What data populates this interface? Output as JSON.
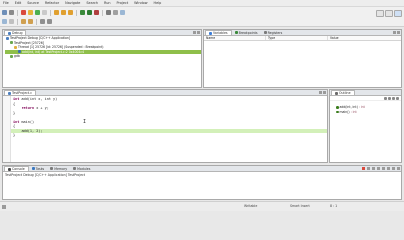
{
  "menu": [
    "File",
    "Edit",
    "Source",
    "Refactor",
    "Navigate",
    "Search",
    "Run",
    "Project",
    "Window",
    "Help"
  ],
  "debug_view": {
    "tab_label": "Debug",
    "tree": [
      "TestProject Debug [C/C++ Application]",
      "TestProject [25726]",
      "Thread [1] 25726 [id: 25726] (Suspended : Breakpoint)",
      "add(int, int) at TestProject.c:2 0x4004c4",
      "gdb"
    ]
  },
  "variables_view": {
    "tabs": [
      "Variables",
      "Breakpoints",
      "Registers"
    ],
    "columns": [
      "Name",
      "Type",
      "Value"
    ]
  },
  "editor": {
    "tab_label": "TestProject.c",
    "lines": [
      {
        "indent": "",
        "kw": "int",
        "rest": " add(int x, int y)"
      },
      {
        "indent": "",
        "kw": "",
        "rest": "{"
      },
      {
        "indent": "    ",
        "kw": "return",
        "rest": " x + y;"
      },
      {
        "indent": "",
        "kw": "",
        "rest": "}"
      },
      {
        "indent": "",
        "kw": "",
        "rest": ""
      },
      {
        "indent": "",
        "kw": "int",
        "rest": " main()"
      },
      {
        "indent": "",
        "kw": "",
        "rest": "{"
      },
      {
        "indent": "    ",
        "kw": "",
        "rest": "add(1, 2);"
      },
      {
        "indent": "",
        "kw": "",
        "rest": "}"
      }
    ],
    "highlighted_line": 7
  },
  "outline_view": {
    "tab_label": "Outline",
    "items": [
      {
        "name": "add(int, int)",
        "type": ": int"
      },
      {
        "name": "main()",
        "type": ": int"
      }
    ]
  },
  "console_view": {
    "tabs": [
      "Console",
      "Tasks",
      "Memory",
      "Modules"
    ],
    "title": "TestProject Debug [C/C++ Application] TestProject"
  },
  "status": {
    "writable": "Writable",
    "insert_mode": "Smart Insert",
    "position": "8 : 1"
  },
  "colors": {
    "selection": "#8fbf4a",
    "current_line": "#d3f0b9",
    "keyword": "#7f0055"
  }
}
